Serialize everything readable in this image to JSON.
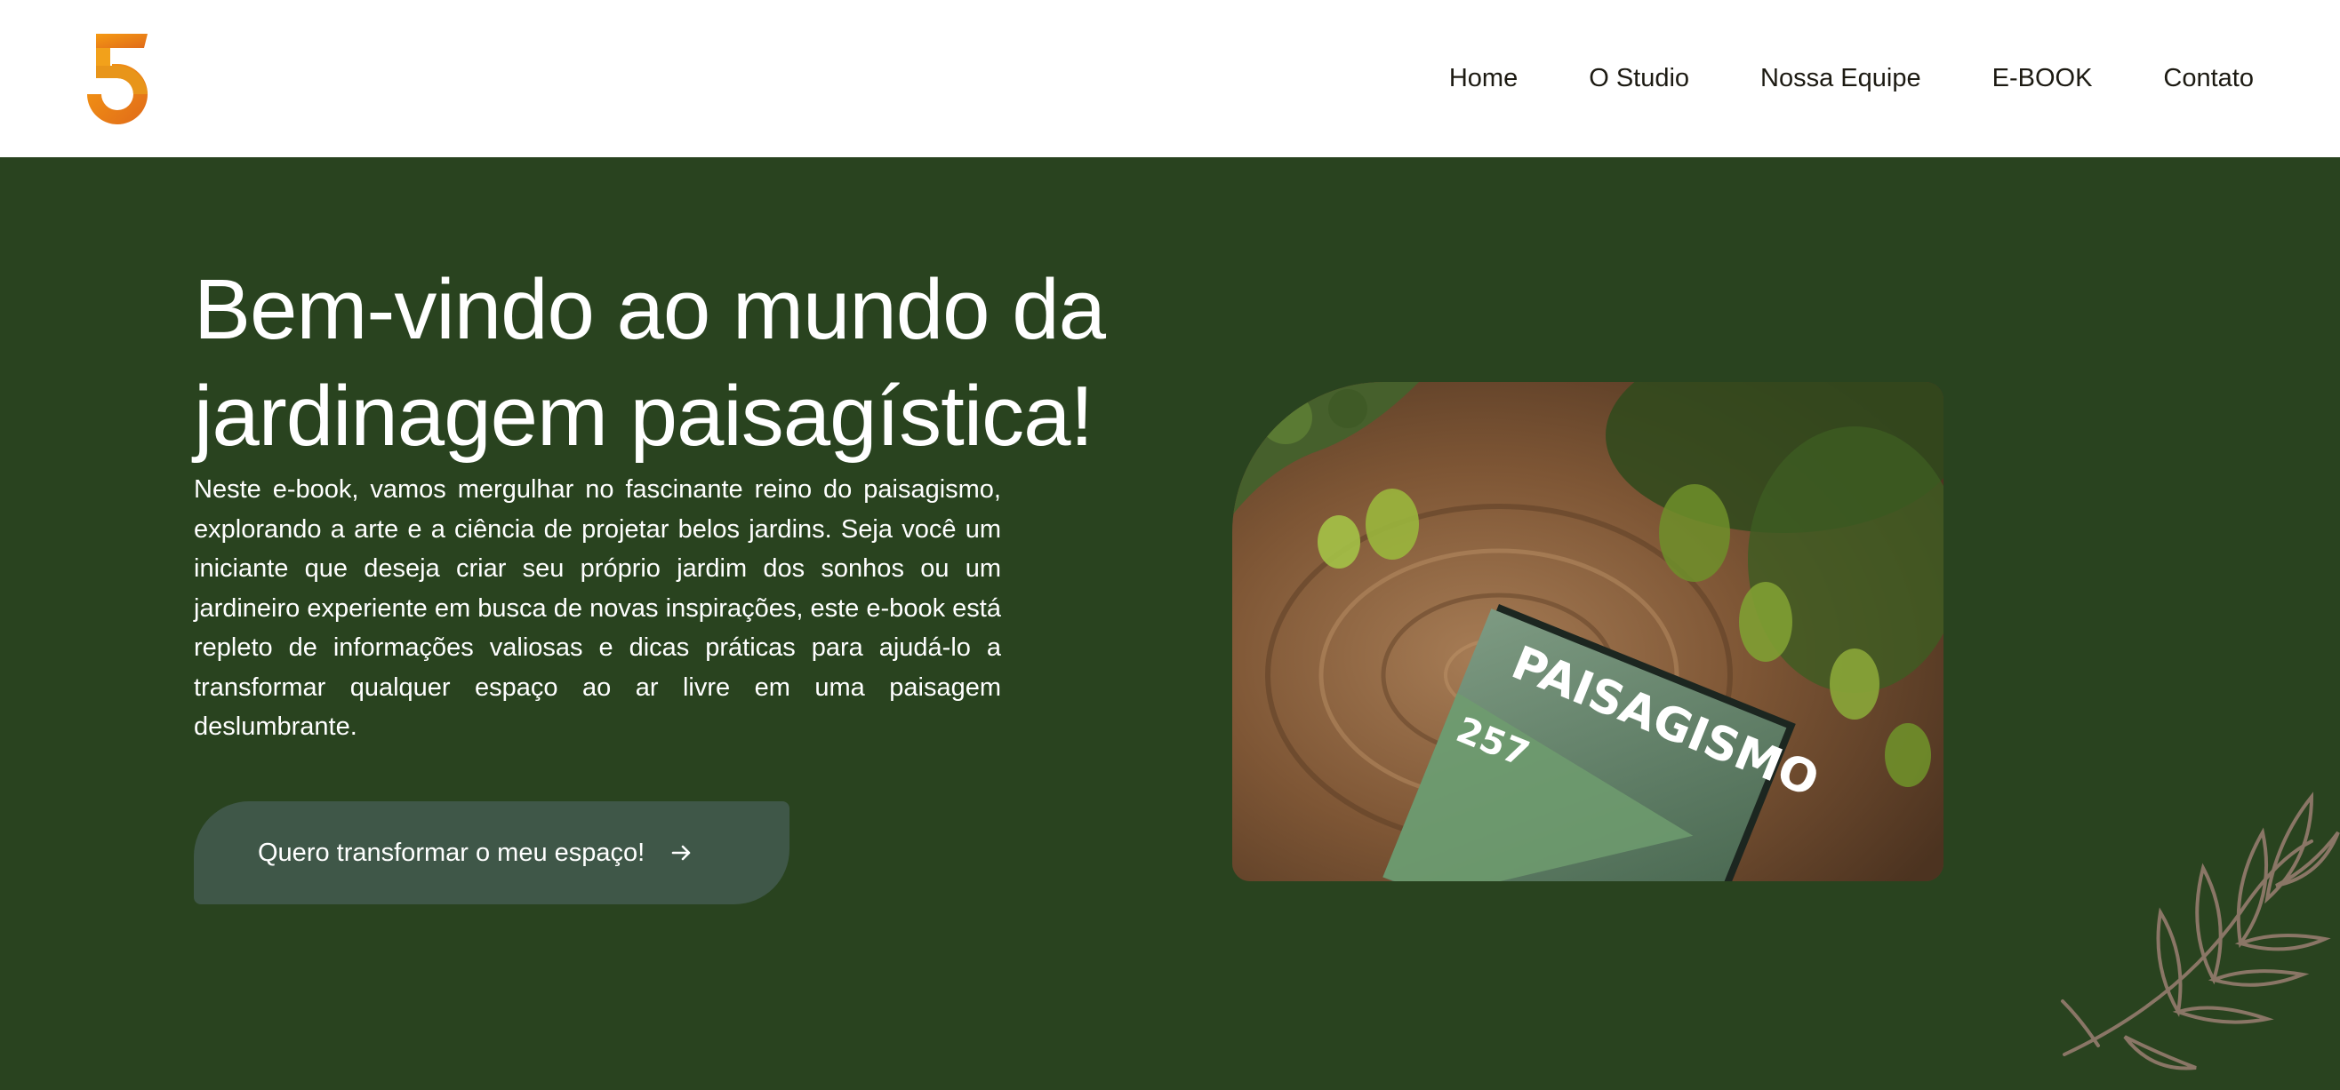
{
  "brand": {
    "logo_icon": "number-five-logo",
    "colors": {
      "primary": "#29431f",
      "accent": "#f08a1c",
      "white": "#ffffff"
    }
  },
  "nav": {
    "items": [
      {
        "label": "Home"
      },
      {
        "label": "O Studio"
      },
      {
        "label": "Nossa Equipe"
      },
      {
        "label": "E-BOOK"
      },
      {
        "label": "Contato"
      }
    ]
  },
  "hero": {
    "title": "Bem-vindo ao mundo da jardinagem paisagística!",
    "description": "Neste e-book, vamos mergulhar no fascinante reino do paisagismo, explorando a arte e a ciência de projetar belos jardins. Seja você um iniciante que deseja criar seu próprio jardim dos sonhos ou um jardineiro experiente em busca de novas inspirações, este e-book está repleto de informações valiosas e dicas práticas para ajudá-lo a transformar qualquer espaço ao ar livre em uma paisagem deslumbrante.",
    "cta_label": "Quero transformar o meu espaço!",
    "cta_icon": "arrow-right-icon"
  },
  "ebook_cover": {
    "title": "PAISAGISMO",
    "number": "257"
  }
}
